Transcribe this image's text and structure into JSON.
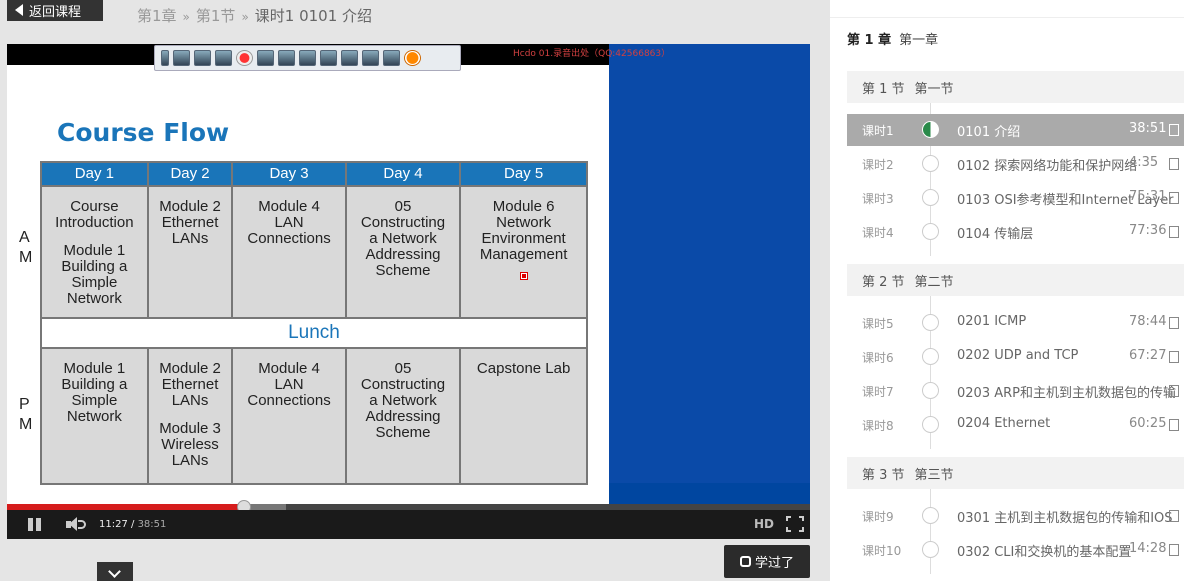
{
  "nav": {
    "back_label": "返回课程"
  },
  "breadcrumb": {
    "chapter": "第1章",
    "section": "第1节",
    "sep": "»",
    "current": "课时1  0101 介绍"
  },
  "slide": {
    "title": "Course Flow",
    "watermark": "Hcdo 01.录音出处（QQ:42566863）",
    "days": [
      "Day 1",
      "Day 2",
      "Day 3",
      "Day 4",
      "Day 5"
    ],
    "am_label": [
      "A",
      "M"
    ],
    "pm_label": [
      "P",
      "M"
    ],
    "am": [
      [
        "Course",
        "Introduction",
        "",
        "Module 1",
        "Building a",
        "Simple",
        "Network"
      ],
      [
        "Module 2",
        "Ethernet",
        "LANs"
      ],
      [
        "Module 4",
        "LAN",
        "Connections"
      ],
      [
        "05",
        "Constructing",
        "a Network",
        "Addressing",
        "Scheme"
      ],
      [
        "Module 6",
        "Network",
        "Environment",
        "Management"
      ]
    ],
    "lunch": "Lunch",
    "pm": [
      [
        "Module 1",
        "Building a",
        "Simple",
        "Network"
      ],
      [
        "Module 2",
        "Ethernet",
        "LANs",
        "",
        "Module 3",
        "Wireless",
        "LANs"
      ],
      [
        "Module 4",
        "LAN",
        "Connections"
      ],
      [
        "05",
        "Constructing",
        "a Network",
        "Addressing",
        "Scheme"
      ],
      [
        "Capstone Lab"
      ]
    ]
  },
  "player": {
    "current_time": "11:27",
    "total_time": "38:51",
    "progress_fraction": 0.295,
    "hd_label": "HD"
  },
  "learned_button": "学过了",
  "sidebar": {
    "chapter": {
      "num": "第 1 章",
      "title": "第一章"
    },
    "sections": [
      {
        "num": "第 1 节",
        "title": "第一节",
        "lessons": [
          {
            "idx": "课时1",
            "title": "0101 介绍",
            "dur": "38:51",
            "active": true
          },
          {
            "idx": "课时2",
            "title": "0102 探索网络功能和保护网络",
            "dur": "4:35"
          },
          {
            "idx": "课时3",
            "title": "0103 OSI参考模型和Internet Layer",
            "dur": "75:31"
          },
          {
            "idx": "课时4",
            "title": "0104 传输层",
            "dur": "77:36"
          }
        ]
      },
      {
        "num": "第 2 节",
        "title": "第二节",
        "lessons": [
          {
            "idx": "课时5",
            "title": "0201 ICMP",
            "dur": "78:44"
          },
          {
            "idx": "课时6",
            "title": "0202 UDP and TCP",
            "dur": "67:27"
          },
          {
            "idx": "课时7",
            "title": "0203 ARP和主机到主机数据包的传输",
            "dur": ""
          },
          {
            "idx": "课时8",
            "title": "0204 Ethernet",
            "dur": "60:25"
          }
        ]
      },
      {
        "num": "第 3 节",
        "title": "第三节",
        "lessons": [
          {
            "idx": "课时9",
            "title": "0301 主机到主机数据包的传输和IOS",
            "dur": ""
          },
          {
            "idx": "课时10",
            "title": "0302 CLI和交换机的基本配置",
            "dur": "14:28"
          }
        ]
      }
    ]
  },
  "colors": {
    "accent_blue": "#1a75b9",
    "progress_red": "#d51c1c",
    "active_lesson_bg": "#aaaaaa"
  }
}
